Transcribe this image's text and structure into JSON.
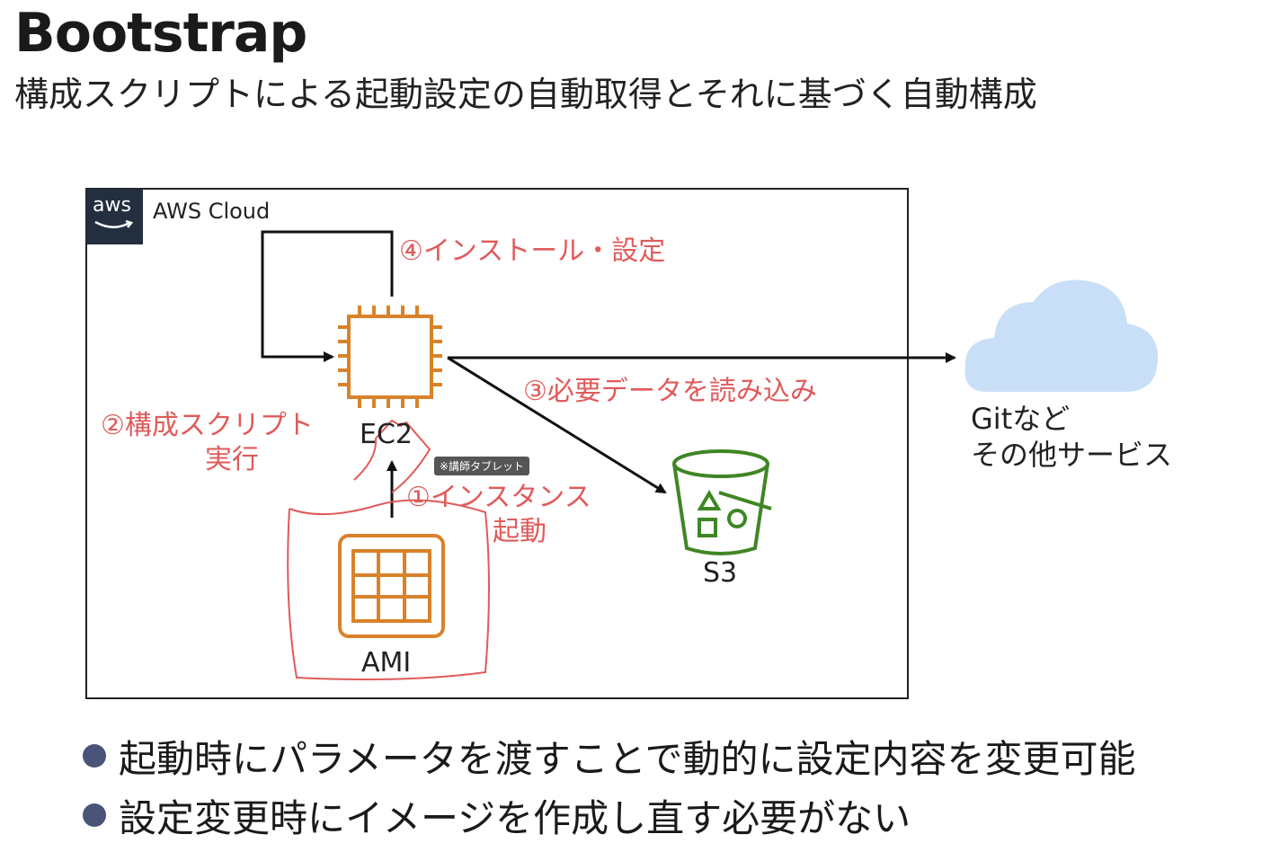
{
  "header": {
    "title": "Bootstrap",
    "subtitle": "構成スクリプトによる起動設定の自動取得とそれに基づく自動構成"
  },
  "aws": {
    "logo_text": "aws",
    "cloud_label": "AWS Cloud"
  },
  "nodes": {
    "ec2": "EC2",
    "ami": "AMI",
    "s3": "S3",
    "external_line1": "Gitなど",
    "external_line2": "その他サービス"
  },
  "steps": {
    "step1_line1": "①インスタンス",
    "step1_line2": "起動",
    "step2_line1": "②構成スクリプト",
    "step2_line2": "実行",
    "step3": "③必要データを読み込み",
    "step4": "④インストール・設定"
  },
  "overlay_badge": "※講師タブレット",
  "bullets": [
    "起動時にパラメータを渡すことで動的に設定内容を変更可能",
    "設定変更時にイメージを作成し直す必要がない"
  ],
  "colors": {
    "orange": "#d9822b",
    "green": "#3f8624",
    "red_annotation": "#e05a5a",
    "cloud_blue": "#c9dff7",
    "aws_dark": "#232f3e",
    "bullet_dot": "#4a5478"
  }
}
